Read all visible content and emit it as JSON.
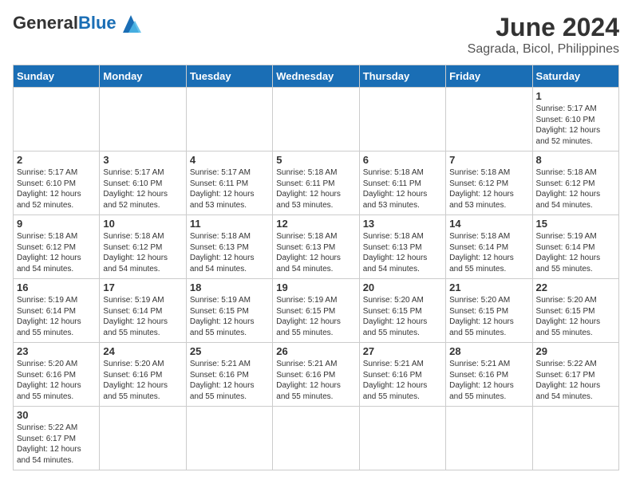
{
  "header": {
    "logo_general": "General",
    "logo_blue": "Blue",
    "title": "June 2024",
    "subtitle": "Sagrada, Bicol, Philippines"
  },
  "days_of_week": [
    "Sunday",
    "Monday",
    "Tuesday",
    "Wednesday",
    "Thursday",
    "Friday",
    "Saturday"
  ],
  "weeks": [
    [
      null,
      null,
      null,
      null,
      null,
      null,
      {
        "day": 1,
        "sunrise": "5:17 AM",
        "sunset": "6:10 PM",
        "daylight_h": 12,
        "daylight_m": 52
      }
    ],
    [
      {
        "day": 2,
        "sunrise": "5:17 AM",
        "sunset": "6:10 PM",
        "daylight_h": 12,
        "daylight_m": 52
      },
      {
        "day": 3,
        "sunrise": "5:17 AM",
        "sunset": "6:10 PM",
        "daylight_h": 12,
        "daylight_m": 52
      },
      {
        "day": 4,
        "sunrise": "5:17 AM",
        "sunset": "6:11 PM",
        "daylight_h": 12,
        "daylight_m": 53
      },
      {
        "day": 5,
        "sunrise": "5:18 AM",
        "sunset": "6:11 PM",
        "daylight_h": 12,
        "daylight_m": 53
      },
      {
        "day": 6,
        "sunrise": "5:18 AM",
        "sunset": "6:11 PM",
        "daylight_h": 12,
        "daylight_m": 53
      },
      {
        "day": 7,
        "sunrise": "5:18 AM",
        "sunset": "6:12 PM",
        "daylight_h": 12,
        "daylight_m": 53
      },
      {
        "day": 8,
        "sunrise": "5:18 AM",
        "sunset": "6:12 PM",
        "daylight_h": 12,
        "daylight_m": 54
      }
    ],
    [
      {
        "day": 9,
        "sunrise": "5:18 AM",
        "sunset": "6:12 PM",
        "daylight_h": 12,
        "daylight_m": 54
      },
      {
        "day": 10,
        "sunrise": "5:18 AM",
        "sunset": "6:12 PM",
        "daylight_h": 12,
        "daylight_m": 54
      },
      {
        "day": 11,
        "sunrise": "5:18 AM",
        "sunset": "6:13 PM",
        "daylight_h": 12,
        "daylight_m": 54
      },
      {
        "day": 12,
        "sunrise": "5:18 AM",
        "sunset": "6:13 PM",
        "daylight_h": 12,
        "daylight_m": 54
      },
      {
        "day": 13,
        "sunrise": "5:18 AM",
        "sunset": "6:13 PM",
        "daylight_h": 12,
        "daylight_m": 54
      },
      {
        "day": 14,
        "sunrise": "5:18 AM",
        "sunset": "6:14 PM",
        "daylight_h": 12,
        "daylight_m": 55
      },
      {
        "day": 15,
        "sunrise": "5:19 AM",
        "sunset": "6:14 PM",
        "daylight_h": 12,
        "daylight_m": 55
      }
    ],
    [
      {
        "day": 16,
        "sunrise": "5:19 AM",
        "sunset": "6:14 PM",
        "daylight_h": 12,
        "daylight_m": 55
      },
      {
        "day": 17,
        "sunrise": "5:19 AM",
        "sunset": "6:14 PM",
        "daylight_h": 12,
        "daylight_m": 55
      },
      {
        "day": 18,
        "sunrise": "5:19 AM",
        "sunset": "6:15 PM",
        "daylight_h": 12,
        "daylight_m": 55
      },
      {
        "day": 19,
        "sunrise": "5:19 AM",
        "sunset": "6:15 PM",
        "daylight_h": 12,
        "daylight_m": 55
      },
      {
        "day": 20,
        "sunrise": "5:20 AM",
        "sunset": "6:15 PM",
        "daylight_h": 12,
        "daylight_m": 55
      },
      {
        "day": 21,
        "sunrise": "5:20 AM",
        "sunset": "6:15 PM",
        "daylight_h": 12,
        "daylight_m": 55
      },
      {
        "day": 22,
        "sunrise": "5:20 AM",
        "sunset": "6:15 PM",
        "daylight_h": 12,
        "daylight_m": 55
      }
    ],
    [
      {
        "day": 23,
        "sunrise": "5:20 AM",
        "sunset": "6:16 PM",
        "daylight_h": 12,
        "daylight_m": 55
      },
      {
        "day": 24,
        "sunrise": "5:20 AM",
        "sunset": "6:16 PM",
        "daylight_h": 12,
        "daylight_m": 55
      },
      {
        "day": 25,
        "sunrise": "5:21 AM",
        "sunset": "6:16 PM",
        "daylight_h": 12,
        "daylight_m": 55
      },
      {
        "day": 26,
        "sunrise": "5:21 AM",
        "sunset": "6:16 PM",
        "daylight_h": 12,
        "daylight_m": 55
      },
      {
        "day": 27,
        "sunrise": "5:21 AM",
        "sunset": "6:16 PM",
        "daylight_h": 12,
        "daylight_m": 55
      },
      {
        "day": 28,
        "sunrise": "5:21 AM",
        "sunset": "6:16 PM",
        "daylight_h": 12,
        "daylight_m": 55
      },
      {
        "day": 29,
        "sunrise": "5:22 AM",
        "sunset": "6:17 PM",
        "daylight_h": 12,
        "daylight_m": 54
      }
    ],
    [
      {
        "day": 30,
        "sunrise": "5:22 AM",
        "sunset": "6:17 PM",
        "daylight_h": 12,
        "daylight_m": 54
      },
      null,
      null,
      null,
      null,
      null,
      null
    ]
  ]
}
